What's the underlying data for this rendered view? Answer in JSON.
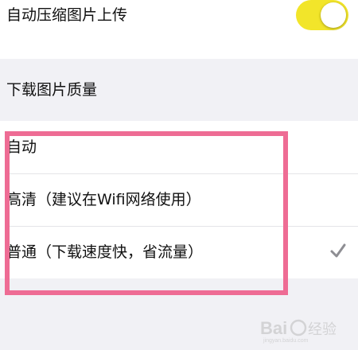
{
  "settings": {
    "auto_compress": {
      "label": "自动压缩图片上传",
      "enabled": true
    },
    "download_quality": {
      "title": "下载图片质量",
      "options": [
        {
          "label": "自动",
          "selected": false
        },
        {
          "label": "高清（建议在Wifi网络使用）",
          "selected": false
        },
        {
          "label": "普通（下载速度快，省流量）",
          "selected": true
        }
      ]
    }
  },
  "colors": {
    "toggle_on": "#f2e52a",
    "highlight": "#ee6c94",
    "checkmark": "#8e8e93"
  },
  "icons": {
    "checkmark": "check-icon"
  }
}
